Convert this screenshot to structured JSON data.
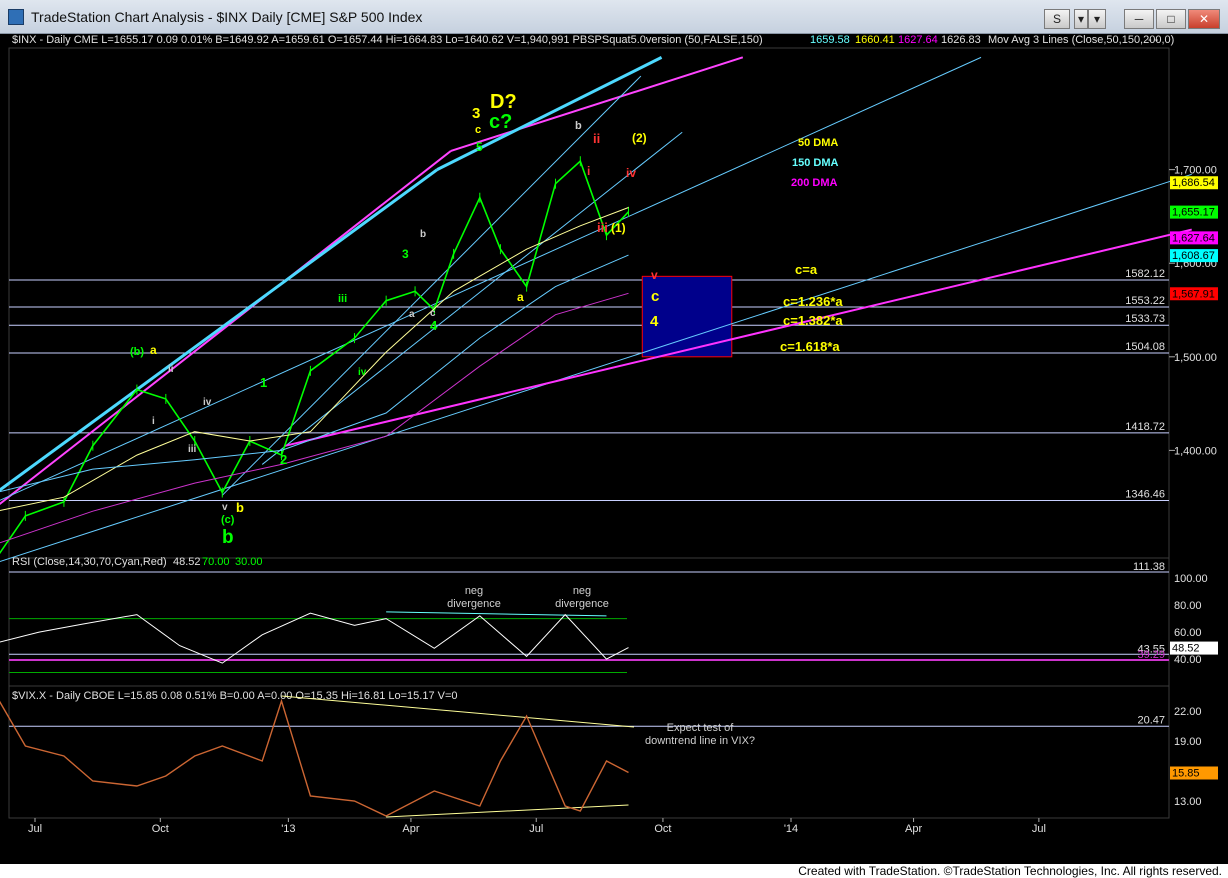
{
  "window": {
    "title": "TradeStation Chart Analysis - $INX Daily [CME] S&P 500 Index",
    "buttons": [
      "S",
      "▾",
      "─",
      "□",
      "✕"
    ]
  },
  "header": {
    "symbol_line": "$INX - Daily  CME  L=1655.17  0.09  0.01%  B=1649.92  A=1659.61  O=1657.44  Hi=1664.83  Lo=1640.62  V=1,940,991  PBSPSquat5.0version (50,FALSE,150)",
    "ma_values": [
      "1659.58",
      "1660.41",
      "1627.64",
      "1626.83"
    ],
    "ma_label": "Mov Avg 3 Lines (Close,50,150,200,0)",
    "close_marks": "- -"
  },
  "chart_data": [
    {
      "type": "line",
      "panel": "price",
      "title": "$INX - Daily",
      "x_tick_labels": [
        "Jul",
        "Oct",
        "'13",
        "Apr",
        "Jul",
        "Oct",
        "'14",
        "Apr",
        "Jul"
      ],
      "y_tick_labels": [
        "1,700.00",
        "1,600.00",
        "1,500.00",
        "1,400.00"
      ],
      "ylim": [
        1285,
        1830
      ],
      "price_tags": [
        {
          "label": "1,686.54",
          "value": 1686.54,
          "color": "#ffff00"
        },
        {
          "label": "1,655.17",
          "value": 1655.17,
          "color": "#00ff00"
        },
        {
          "label": "1,627.64",
          "value": 1627.64,
          "color": "#ff00ff"
        },
        {
          "label": "1,608.67",
          "value": 1608.67,
          "color": "#00ffff"
        },
        {
          "label": "1,567.91",
          "value": 1567.91,
          "color": "#ff0000"
        }
      ],
      "horizontal_levels": [
        {
          "label": "1582.12",
          "value": 1582.12
        },
        {
          "label": "1553.22",
          "value": 1553.22
        },
        {
          "label": "1533.73",
          "value": 1533.73
        },
        {
          "label": "1504.08",
          "value": 1504.08
        },
        {
          "label": "1418.72",
          "value": 1418.72
        },
        {
          "label": "1346.46",
          "value": 1346.46
        }
      ],
      "series": [
        {
          "name": "$INX",
          "color": "#00ff00",
          "x": [
            "2012-06-04",
            "2012-06-25",
            "2012-07-23",
            "2012-08-13",
            "2012-09-14",
            "2012-10-05",
            "2012-10-26",
            "2012-11-15",
            "2012-12-05",
            "2012-12-28",
            "2013-01-18",
            "2013-02-19",
            "2013-03-14",
            "2013-04-04",
            "2013-04-18",
            "2013-05-02",
            "2013-05-21",
            "2013-06-05",
            "2013-06-24",
            "2013-07-15",
            "2013-08-02",
            "2013-08-21",
            "2013-09-06"
          ],
          "y": [
            1285,
            1330,
            1345,
            1405,
            1465,
            1455,
            1410,
            1355,
            1410,
            1395,
            1485,
            1520,
            1560,
            1570,
            1550,
            1610,
            1670,
            1615,
            1575,
            1685,
            1709,
            1630,
            1655
          ]
        },
        {
          "name": "50 DMA",
          "color": "#ffff99",
          "x": [
            "2012-06-04",
            "2012-07-23",
            "2012-09-14",
            "2012-10-26",
            "2012-12-05",
            "2013-01-18",
            "2013-03-14",
            "2013-05-02",
            "2013-06-24",
            "2013-08-02",
            "2013-09-06"
          ],
          "y": [
            1335,
            1350,
            1395,
            1420,
            1410,
            1420,
            1505,
            1570,
            1615,
            1640,
            1659.58
          ]
        },
        {
          "name": "150 DMA",
          "color": "#66ccff",
          "x": [
            "2012-06-04",
            "2012-08-13",
            "2012-10-26",
            "2012-12-28",
            "2013-03-14",
            "2013-05-21",
            "2013-07-15",
            "2013-09-06"
          ],
          "y": [
            1355,
            1380,
            1390,
            1400,
            1440,
            1520,
            1575,
            1608.67
          ]
        },
        {
          "name": "200 DMA",
          "color": "#cc33cc",
          "x": [
            "2012-06-04",
            "2012-08-13",
            "2012-10-26",
            "2012-12-28",
            "2013-03-14",
            "2013-05-21",
            "2013-07-15",
            "2013-09-06"
          ],
          "y": [
            1300,
            1335,
            1365,
            1385,
            1415,
            1490,
            1545,
            1567.91
          ]
        }
      ],
      "legend_labels": [
        {
          "text": "50 DMA",
          "color": "#ffff00"
        },
        {
          "text": "150 DMA",
          "color": "#66ffff"
        },
        {
          "text": "200 DMA",
          "color": "#ff00ff"
        }
      ],
      "annotations": [
        {
          "text": "D?",
          "color": "#ffff00"
        },
        {
          "text": "c?",
          "color": "#00ff00"
        },
        {
          "text": "3",
          "color": "#ffff00"
        },
        {
          "text": "c",
          "color": "#ffff00"
        },
        {
          "text": "5",
          "color": "#00ff00"
        },
        {
          "text": "b",
          "color": "#cccccc"
        },
        {
          "text": "ii",
          "color": "#ff3333"
        },
        {
          "text": "i",
          "color": "#ff3333"
        },
        {
          "text": "iv",
          "color": "#ff3333"
        },
        {
          "text": "iii",
          "color": "#ff3333"
        },
        {
          "text": "(1)",
          "color": "#ffff00"
        },
        {
          "text": "(2)",
          "color": "#ffff00"
        },
        {
          "text": "a",
          "color": "#ffff00"
        },
        {
          "text": "3",
          "color": "#00ff00"
        },
        {
          "text": "b",
          "color": "#cccccc"
        },
        {
          "text": "a",
          "color": "#cccccc"
        },
        {
          "text": "c",
          "color": "#cccccc"
        },
        {
          "text": "4",
          "color": "#00ff00"
        },
        {
          "text": "iii",
          "color": "#00ff00"
        },
        {
          "text": "iv",
          "color": "#00ff00"
        },
        {
          "text": "1",
          "color": "#00ff00"
        },
        {
          "text": "2",
          "color": "#00ff00"
        },
        {
          "text": "(b)",
          "color": "#00ff00"
        },
        {
          "text": "a",
          "color": "#ffff00"
        },
        {
          "text": "ii",
          "color": "#cccccc"
        },
        {
          "text": "i",
          "color": "#cccccc"
        },
        {
          "text": "iv",
          "color": "#cccccc"
        },
        {
          "text": "iii",
          "color": "#cccccc"
        },
        {
          "text": "v",
          "color": "#cccccc"
        },
        {
          "text": "(c)",
          "color": "#00ff00"
        },
        {
          "text": "b",
          "color": "#ffff00"
        },
        {
          "text": "b",
          "color": "#00ff00"
        },
        {
          "text": "v",
          "color": "#ff3333"
        },
        {
          "text": "c",
          "color": "#ffff00"
        },
        {
          "text": "4",
          "color": "#ffff00"
        },
        {
          "text": "c=a",
          "color": "#ffff00"
        },
        {
          "text": "c=1.236*a",
          "color": "#ffff00"
        },
        {
          "text": "c=1.382*a",
          "color": "#ffff00"
        },
        {
          "text": "c=1.618*a",
          "color": "#ffff00"
        }
      ]
    },
    {
      "type": "line",
      "panel": "rsi",
      "title": "RSI (Close,14,30,70,Cyan,Red)",
      "header_values": [
        "48.52",
        "70.00",
        "30.00"
      ],
      "y_tick_labels": [
        "100.00",
        "80.00",
        "60.00",
        "40.00"
      ],
      "ylim": [
        20,
        115
      ],
      "levels": [
        {
          "label": "111.38",
          "value": 111.38
        },
        {
          "label": "43.55",
          "value": 43.55
        },
        {
          "label": "39.29",
          "value": 39.29
        }
      ],
      "last_value": {
        "label": "48.52",
        "value": 48.52
      },
      "series": [
        {
          "name": "RSI",
          "color": "#ffffff",
          "x": [
            "2012-06-04",
            "2012-07-05",
            "2012-08-06",
            "2012-09-14",
            "2012-10-15",
            "2012-11-15",
            "2012-12-14",
            "2013-01-18",
            "2013-02-19",
            "2013-03-14",
            "2013-04-18",
            "2013-05-21",
            "2013-06-24",
            "2013-07-22",
            "2013-08-21",
            "2013-09-06"
          ],
          "y": [
            52,
            60,
            66,
            73,
            50,
            37,
            58,
            74,
            65,
            70,
            48,
            72,
            42,
            73,
            40,
            48.52
          ]
        }
      ],
      "annotations": [
        {
          "text": "neg divergence"
        },
        {
          "text": "neg divergence"
        }
      ]
    },
    {
      "type": "line",
      "panel": "vix",
      "title": "$VIX.X - Daily  CBOE  L=15.85  0.08  0.51%  B=0.00  A=0.00  O=15.35  Hi=16.81  Lo=15.17  V=0",
      "y_tick_labels": [
        "22.00",
        "19.00",
        "16.00",
        "13.00"
      ],
      "ylim": [
        11.3,
        24.5
      ],
      "levels": [
        {
          "label": "20.47",
          "value": 20.47
        }
      ],
      "last_value": {
        "label": "15.85",
        "value": 15.85
      },
      "series": [
        {
          "name": "$VIX.X",
          "color": "#cc6633",
          "x": [
            "2012-06-04",
            "2012-06-25",
            "2012-07-23",
            "2012-08-13",
            "2012-09-14",
            "2012-10-05",
            "2012-10-26",
            "2012-11-15",
            "2012-12-14",
            "2012-12-28",
            "2013-01-18",
            "2013-02-19",
            "2013-03-14",
            "2013-04-18",
            "2013-05-21",
            "2013-06-05",
            "2013-06-24",
            "2013-07-22",
            "2013-08-02",
            "2013-08-21",
            "2013-09-06"
          ],
          "y": [
            23.5,
            18.5,
            17.5,
            15.0,
            14.5,
            15.5,
            17.5,
            18.5,
            17.0,
            23.0,
            13.5,
            13.0,
            11.5,
            14.0,
            12.5,
            17.0,
            21.5,
            12.5,
            12.0,
            17.0,
            15.85
          ]
        }
      ],
      "annotations": [
        {
          "text": "Expect test of downtrend line in VIX?"
        }
      ]
    }
  ],
  "footer": {
    "text": "Created with TradeStation. ©TradeStation Technologies, Inc. All rights reserved."
  }
}
